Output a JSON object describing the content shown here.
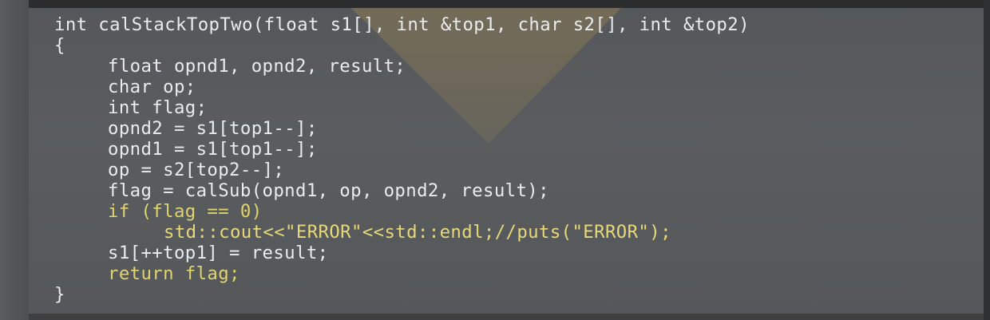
{
  "code": {
    "lines": [
      "int calStackTopTwo(float s1[], int &top1, char s2[], int &top2)",
      "{",
      "float opnd1, opnd2, result;",
      "char op;",
      "int flag;",
      "opnd2 = s1[top1--];",
      "opnd1 = s1[top1--];",
      "op = s2[top2--];",
      "flag = calSub(opnd1, op, opnd2, result);",
      "if (flag == 0)",
      "std::cout<<\"ERROR\"<<std::endl;//puts(\"ERROR\");",
      "s1[++top1] = result;",
      "return flag;",
      "}"
    ]
  },
  "colors": {
    "background": "#55585a",
    "text": "#e9ecee",
    "highlight": "#e1d36e",
    "triangle": "#8a7a55"
  }
}
